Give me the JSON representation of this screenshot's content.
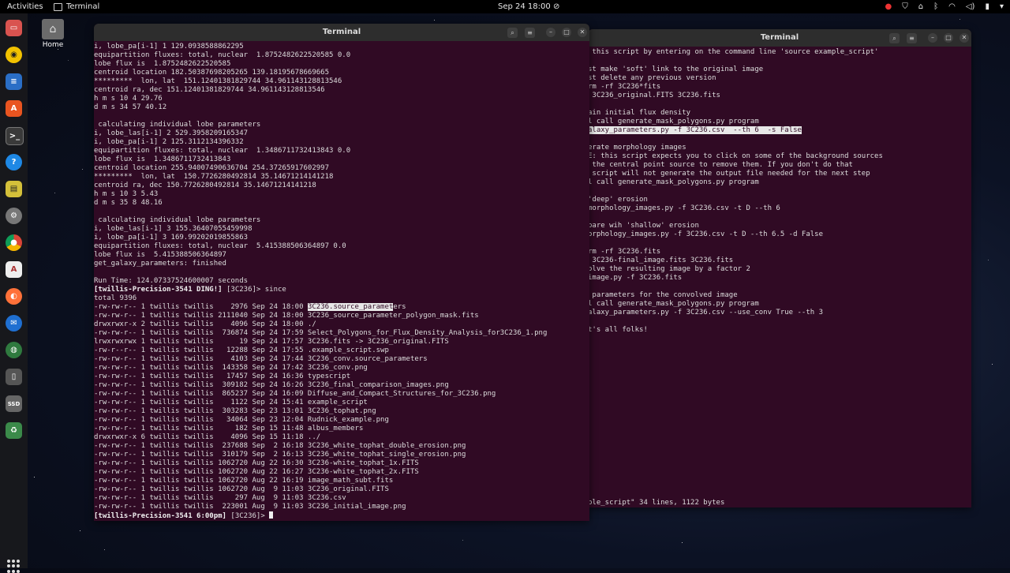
{
  "topbar": {
    "activities": "Activities",
    "app_name": "Terminal",
    "clock": "Sep 24 18:00"
  },
  "desktop": {
    "home_label": "Home"
  },
  "terminal_left": {
    "title": "Terminal",
    "lines_a": [
      "i, lobe_pa[i-1] 1 129.0938588862295",
      "equipartition fluxes: total, nuclear  1.8752482622520585 0.0",
      "lobe flux is  1.8752482622520585",
      "centroid location 182.50387698205265 139.18195678669665",
      "*********  lon, lat  151.12401381829744 34.961143128813546",
      "centroid ra, dec 151.12401381829744 34.961143128813546",
      "h m s 10 4 29.76",
      "d m s 34 57 40.12",
      "",
      " calculating individual lobe parameters",
      "i, lobe_las[i-1] 2 529.3958209165347",
      "i, lobe_pa[i-1] 2 125.3112134396332",
      "equipartition fluxes: total, nuclear  1.3486711732413843 0.0",
      "lobe flux is  1.3486711732413843",
      "centroid location 255.94007490636704 254.37265917602997",
      "*********  lon, lat  150.7726280492814 35.14671214141218",
      "centroid ra, dec 150.7726280492814 35.14671214141218",
      "h m s 10 3 5.43",
      "d m s 35 8 48.16",
      "",
      " calculating individual lobe parameters",
      "i, lobe_las[i-1] 3 155.36407055459998",
      "i, lobe_pa[i-1] 3 169.99202019855863",
      "equipartition fluxes: total, nuclear  5.415388506364897 0.0",
      "lobe flux is  5.415388506364897",
      "get_galaxy_parameters: finished",
      "",
      "Run Time: 124.07337524600007 seconds"
    ],
    "prompt1": "[twillis-Precision-3541 DING!]",
    "prompt1_rest": " [3C236]> since",
    "total_line": "total 9396",
    "first_listing_prefix": "-rw-rw-r-- 1 twillis twillis    2976 Sep 24 18:00 ",
    "first_listing_highlight": "3C236.source_paramet",
    "first_listing_suffix": "ers",
    "lines_b": [
      "-rw-rw-r-- 1 twillis twillis 2111040 Sep 24 18:00 3C236_source_parameter_polygon_mask.fits",
      "drwxrwxr-x 2 twillis twillis    4096 Sep 24 18:00 ./",
      "-rw-rw-r-- 1 twillis twillis  736874 Sep 24 17:59 Select_Polygons_for_Flux_Density_Analysis_for3C236_1.png",
      "lrwxrwxrwx 1 twillis twillis      19 Sep 24 17:57 3C236.fits -> 3C236_original.FITS",
      "-rw-r--r-- 1 twillis twillis   12288 Sep 24 17:55 .example_script.swp",
      "-rw-rw-r-- 1 twillis twillis    4103 Sep 24 17:44 3C236_conv.source_parameters",
      "-rw-rw-r-- 1 twillis twillis  143358 Sep 24 17:42 3C236_conv.png",
      "-rw-rw-r-- 1 twillis twillis   17457 Sep 24 16:36 typescript",
      "-rw-rw-r-- 1 twillis twillis  309182 Sep 24 16:26 3C236_final_comparison_images.png",
      "-rw-rw-r-- 1 twillis twillis  865237 Sep 24 16:09 Diffuse_and_Compact_Structures_for_3C236.png",
      "-rw-rw-r-- 1 twillis twillis    1122 Sep 24 15:41 example_script",
      "-rw-rw-r-- 1 twillis twillis  303283 Sep 23 13:01 3C236_tophat.png",
      "-rw-rw-r-- 1 twillis twillis   34064 Sep 23 12:04 Rudnick_example.png",
      "-rw-rw-r-- 1 twillis twillis     182 Sep 15 11:48 albus_members",
      "drwxrwxr-x 6 twillis twillis    4096 Sep 15 11:18 ../",
      "-rw-rw-r-- 1 twillis twillis  237688 Sep  2 16:18 3C236_white_tophat_double_erosion.png",
      "-rw-rw-r-- 1 twillis twillis  310179 Sep  2 16:13 3C236_white_tophat_single_erosion.png",
      "-rw-rw-r-- 1 twillis twillis 1062720 Aug 22 16:30 3C236-white_tophat_1x.FITS",
      "-rw-rw-r-- 1 twillis twillis 1062720 Aug 22 16:27 3C236-white_tophat_2x.FITS",
      "-rw-rw-r-- 1 twillis twillis 1062720 Aug 22 16:19 image_math_subt.fits",
      "-rw-rw-r-- 1 twillis twillis 1062720 Aug  9 11:03 3C236_original.FITS",
      "-rw-rw-r-- 1 twillis twillis     297 Aug  9 11:03 3C236.csv",
      "-rw-rw-r-- 1 twillis twillis  223001 Aug  9 11:03 3C236_initial_image.png"
    ],
    "prompt2": "[twillis-Precision-3541 6:00pm]",
    "prompt2_rest": " [3C236]> "
  },
  "terminal_right": {
    "title": "Terminal",
    "lines_a": [
      " this script by entering on the command line 'source example_script'",
      "",
      "st make 'soft' link to the original image",
      "st delete any previous version",
      "rm -rf 3C236*fits",
      " 3C236_original.FITS 3C236.fits",
      "",
      "ain initial flux density",
      "l call generate_mask_polygons.py program"
    ],
    "highlight_line": "alaxy_parameters.py -f 3C236.csv  --th 6  -s False",
    "lines_b": [
      "",
      "erate morphology images",
      "E: this script expects you to click on some of the background sources",
      " the central point source to remove them. If you don't do that",
      " script will not generate the output file needed for the next step",
      "l call generate_mask_polygons.py program",
      "",
      "'deep' erosion",
      "morphology_images.py -f 3C236.csv -t D --th 6",
      "",
      "pare wih 'shallow' erosion",
      "orphology_images.py -f 3C236.csv -t D --th 6.5 -d False",
      "",
      "rm -rf 3C236.fits",
      " 3C236-final_image.fits 3C236.fits",
      "olve the resulting image by a factor 2",
      "image.py -f 3C236.fits",
      "",
      " parameters for the convolved image",
      "l call generate_mask_polygons.py program",
      "alaxy_parameters.py -f 3C236.csv --use_conv True --th 3",
      "",
      "t's all folks!"
    ],
    "status_line": "ple_script\" 34 lines, 1122 bytes"
  },
  "colors": {
    "terminal_bg": "#300a24",
    "titlebar_bg": "#2d2d2d",
    "topbar_bg": "#000000"
  }
}
